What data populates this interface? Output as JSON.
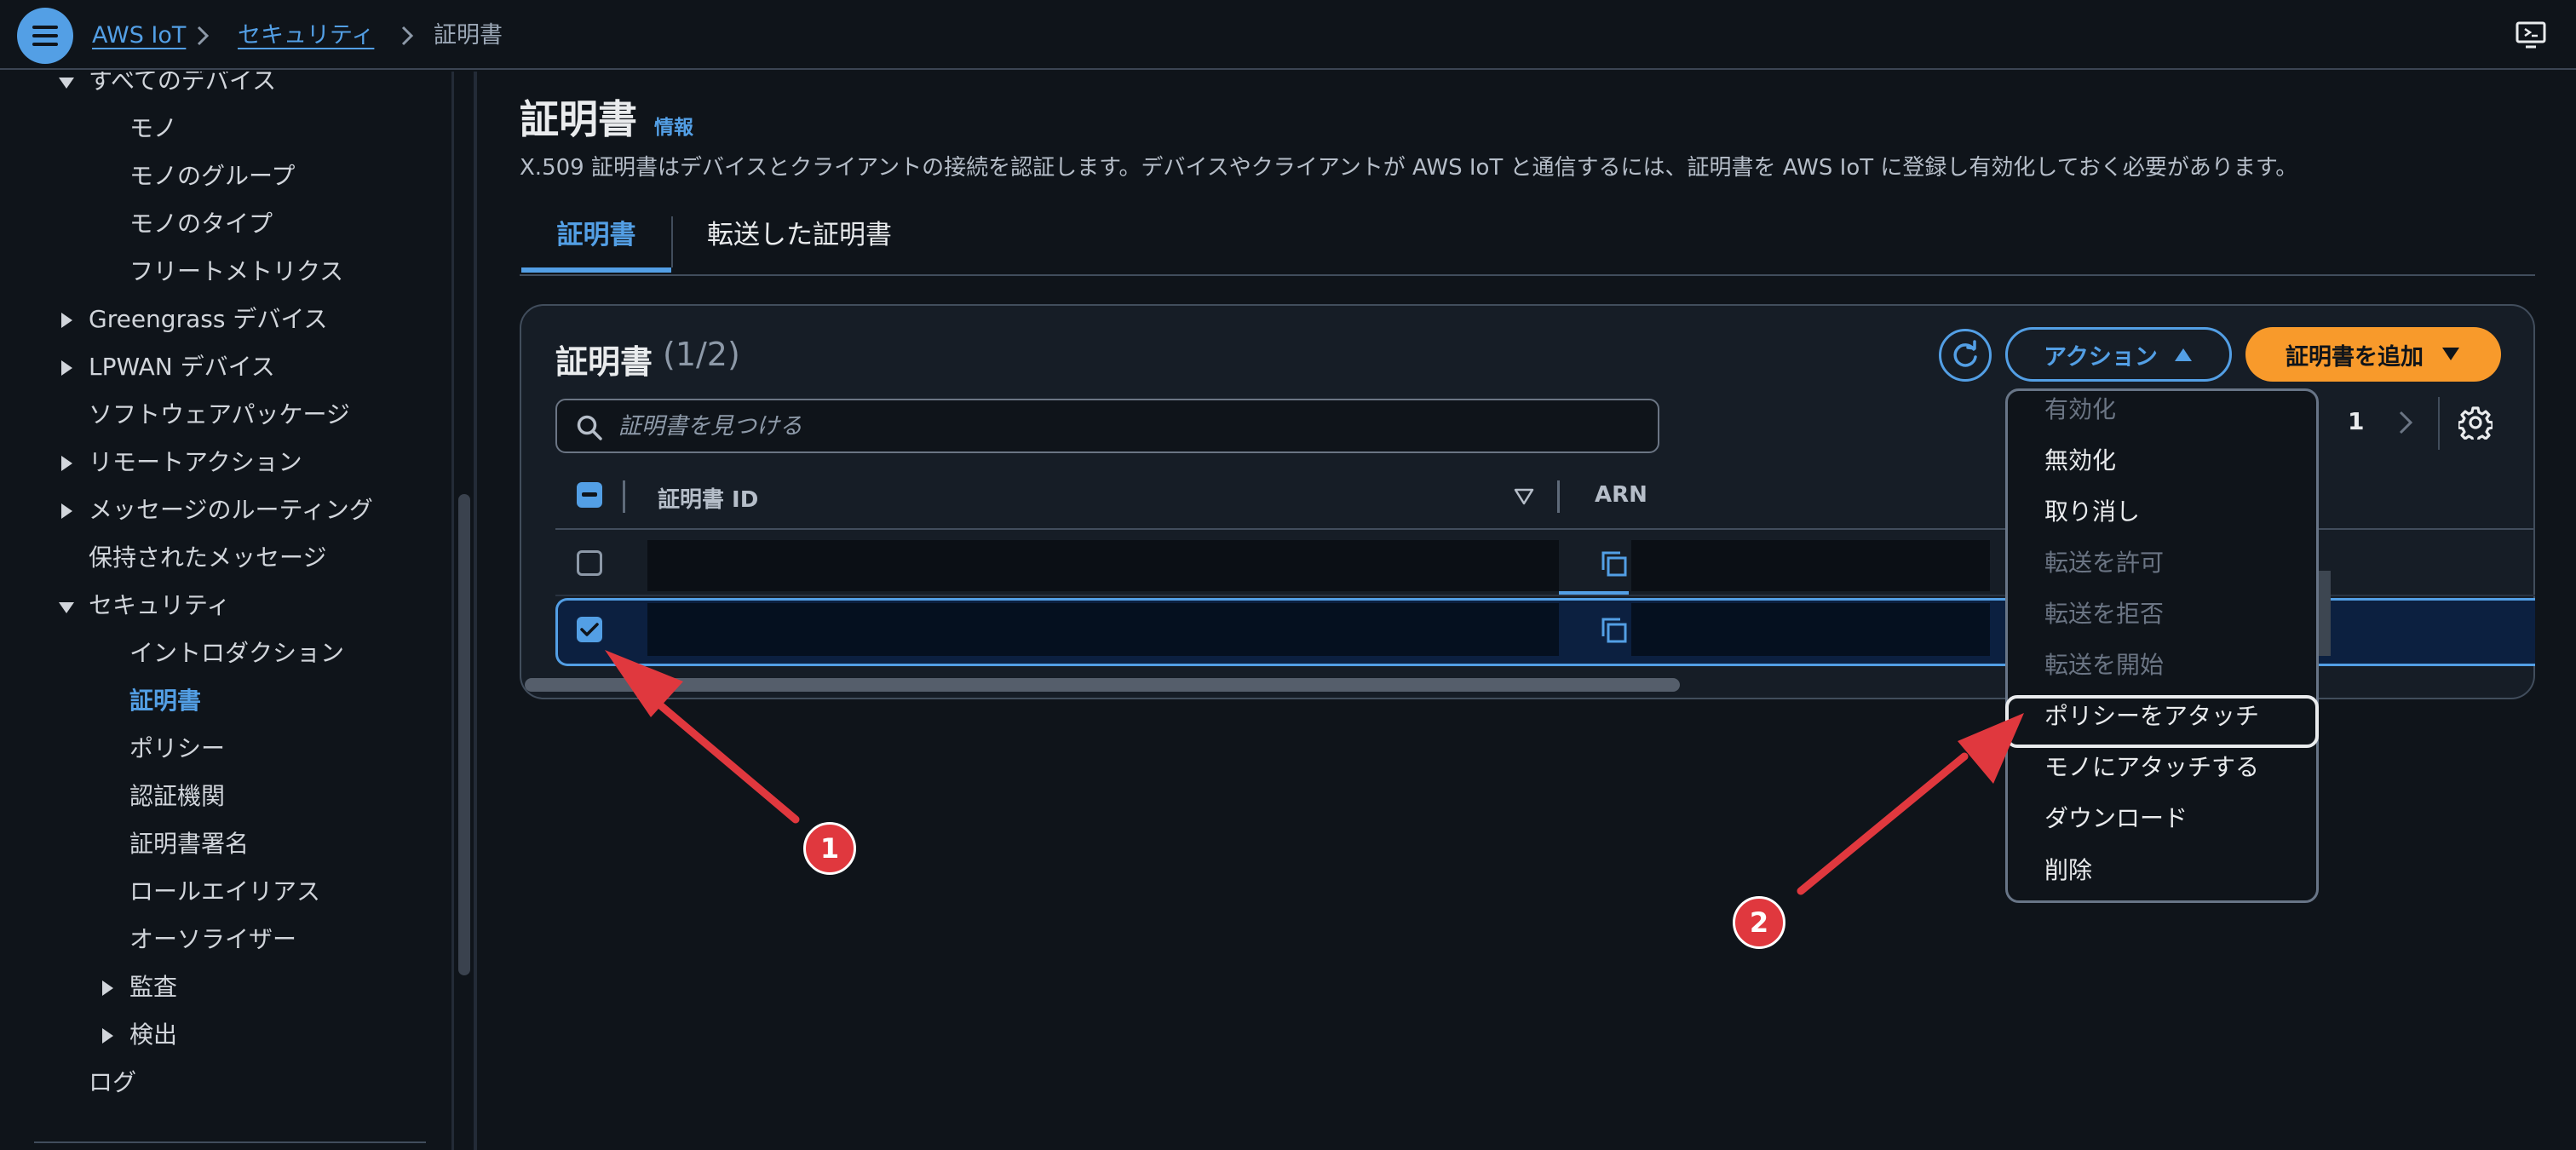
{
  "colors": {
    "background": "#0f141a",
    "accent": "#539fe5",
    "primary_button": "#f89a2b",
    "annotation": "#e0383e"
  },
  "header": {
    "menu_icon": "hamburger-menu-icon",
    "breadcrumb": [
      "AWS IoT",
      "セキュリティ",
      "証明書"
    ],
    "feedback_icon": "feedback-screen-icon"
  },
  "sidebar": {
    "items": [
      {
        "label": "すべてのデバイス",
        "expander": "open"
      },
      {
        "label": "モノ"
      },
      {
        "label": "モノのグループ"
      },
      {
        "label": "モノのタイプ"
      },
      {
        "label": "フリートメトリクス"
      },
      {
        "label": "Greengrass デバイス",
        "expander": "closed"
      },
      {
        "label": "LPWAN デバイス",
        "expander": "closed"
      },
      {
        "label": "ソフトウェアパッケージ"
      },
      {
        "label": "リモートアクション",
        "expander": "closed"
      },
      {
        "label": "メッセージのルーティング",
        "expander": "closed"
      },
      {
        "label": "保持されたメッセージ"
      },
      {
        "label": "セキュリティ",
        "expander": "open"
      },
      {
        "label": "イントロダクション"
      },
      {
        "label": "証明書",
        "active": true
      },
      {
        "label": "ポリシー"
      },
      {
        "label": "認証機関"
      },
      {
        "label": "証明書署名"
      },
      {
        "label": "ロールエイリアス"
      },
      {
        "label": "オーソライザー"
      },
      {
        "label": "監査",
        "expander": "closed"
      },
      {
        "label": "検出",
        "expander": "closed"
      },
      {
        "label": "ログ"
      }
    ]
  },
  "page": {
    "title": "証明書",
    "info_link": "情報",
    "description": "X.509 証明書はデバイスとクライアントの接続を認証します。デバイスやクライアントが AWS IoT と通信するには、証明書を AWS IoT に登録し有効化しておく必要があります。",
    "tabs": [
      {
        "label": "証明書",
        "active": true
      },
      {
        "label": "転送した証明書"
      }
    ]
  },
  "table": {
    "title": "証明書",
    "count": "(1/2)",
    "refresh_icon": "refresh-icon",
    "actions_label": "アクション",
    "add_label": "証明書を追加",
    "search_placeholder": "証明書を見つける",
    "current_page": "1",
    "columns": [
      "証明書 ID",
      "ARN"
    ],
    "rows": [
      {
        "selected": false
      },
      {
        "selected": true
      }
    ]
  },
  "actions_menu": {
    "open": true,
    "items": [
      {
        "label": "有効化",
        "enabled": false
      },
      {
        "label": "無効化",
        "enabled": true
      },
      {
        "label": "取り消し",
        "enabled": true
      },
      {
        "label": "転送を許可",
        "enabled": false
      },
      {
        "label": "転送を拒否",
        "enabled": false
      },
      {
        "label": "転送を開始",
        "enabled": false
      },
      {
        "label": "ポリシーをアタッチ",
        "enabled": true,
        "highlighted": true
      },
      {
        "label": "モノにアタッチする",
        "enabled": true
      },
      {
        "label": "ダウンロード",
        "enabled": true
      },
      {
        "label": "削除",
        "enabled": true
      }
    ]
  },
  "annotations": {
    "badges": [
      "1",
      "2"
    ]
  }
}
